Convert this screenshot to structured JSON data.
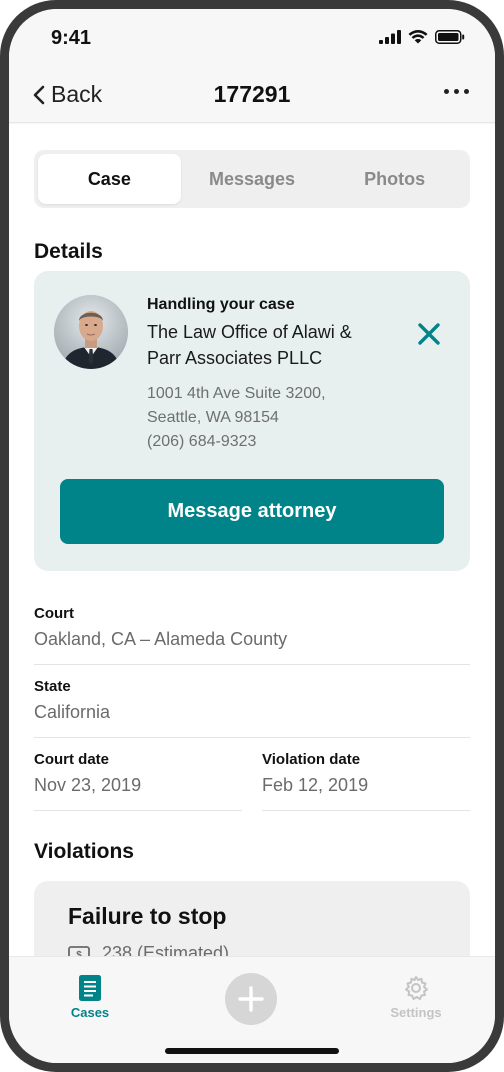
{
  "status_bar": {
    "time": "9:41"
  },
  "nav": {
    "back_label": "Back",
    "title": "177291"
  },
  "tabs": [
    {
      "label": "Case",
      "active": true
    },
    {
      "label": "Messages",
      "active": false
    },
    {
      "label": "Photos",
      "active": false
    }
  ],
  "details": {
    "section_title": "Details",
    "attorney": {
      "heading": "Handling your case",
      "firm_line1": "The Law Office of Alawi &",
      "firm_line2": "Parr Associates PLLC",
      "address_line1": "1001 4th Ave Suite 3200,",
      "address_line2": "Seattle, WA 98154",
      "phone": "(206) 684-9323",
      "message_button": "Message attorney"
    },
    "court": {
      "label": "Court",
      "value": "Oakland, CA – Alameda County"
    },
    "state": {
      "label": "State",
      "value": "California"
    },
    "court_date": {
      "label": "Court date",
      "value": "Nov 23, 2019"
    },
    "violation_date": {
      "label": "Violation date",
      "value": "Feb 12, 2019"
    }
  },
  "violations": {
    "section_title": "Violations",
    "items": [
      {
        "title": "Failure to stop",
        "amount": "238 (Estimated)",
        "icon": "dollar-bill-icon"
      }
    ]
  },
  "tab_bar": {
    "items": [
      {
        "label": "Cases",
        "icon": "document-icon",
        "active": true
      },
      {
        "label": "Settings",
        "icon": "gear-icon",
        "active": false
      }
    ],
    "add_icon": "plus-icon"
  },
  "colors": {
    "accent": "#00848a",
    "card_bg": "#e7f0ef",
    "muted_text": "#6b6b6b"
  }
}
